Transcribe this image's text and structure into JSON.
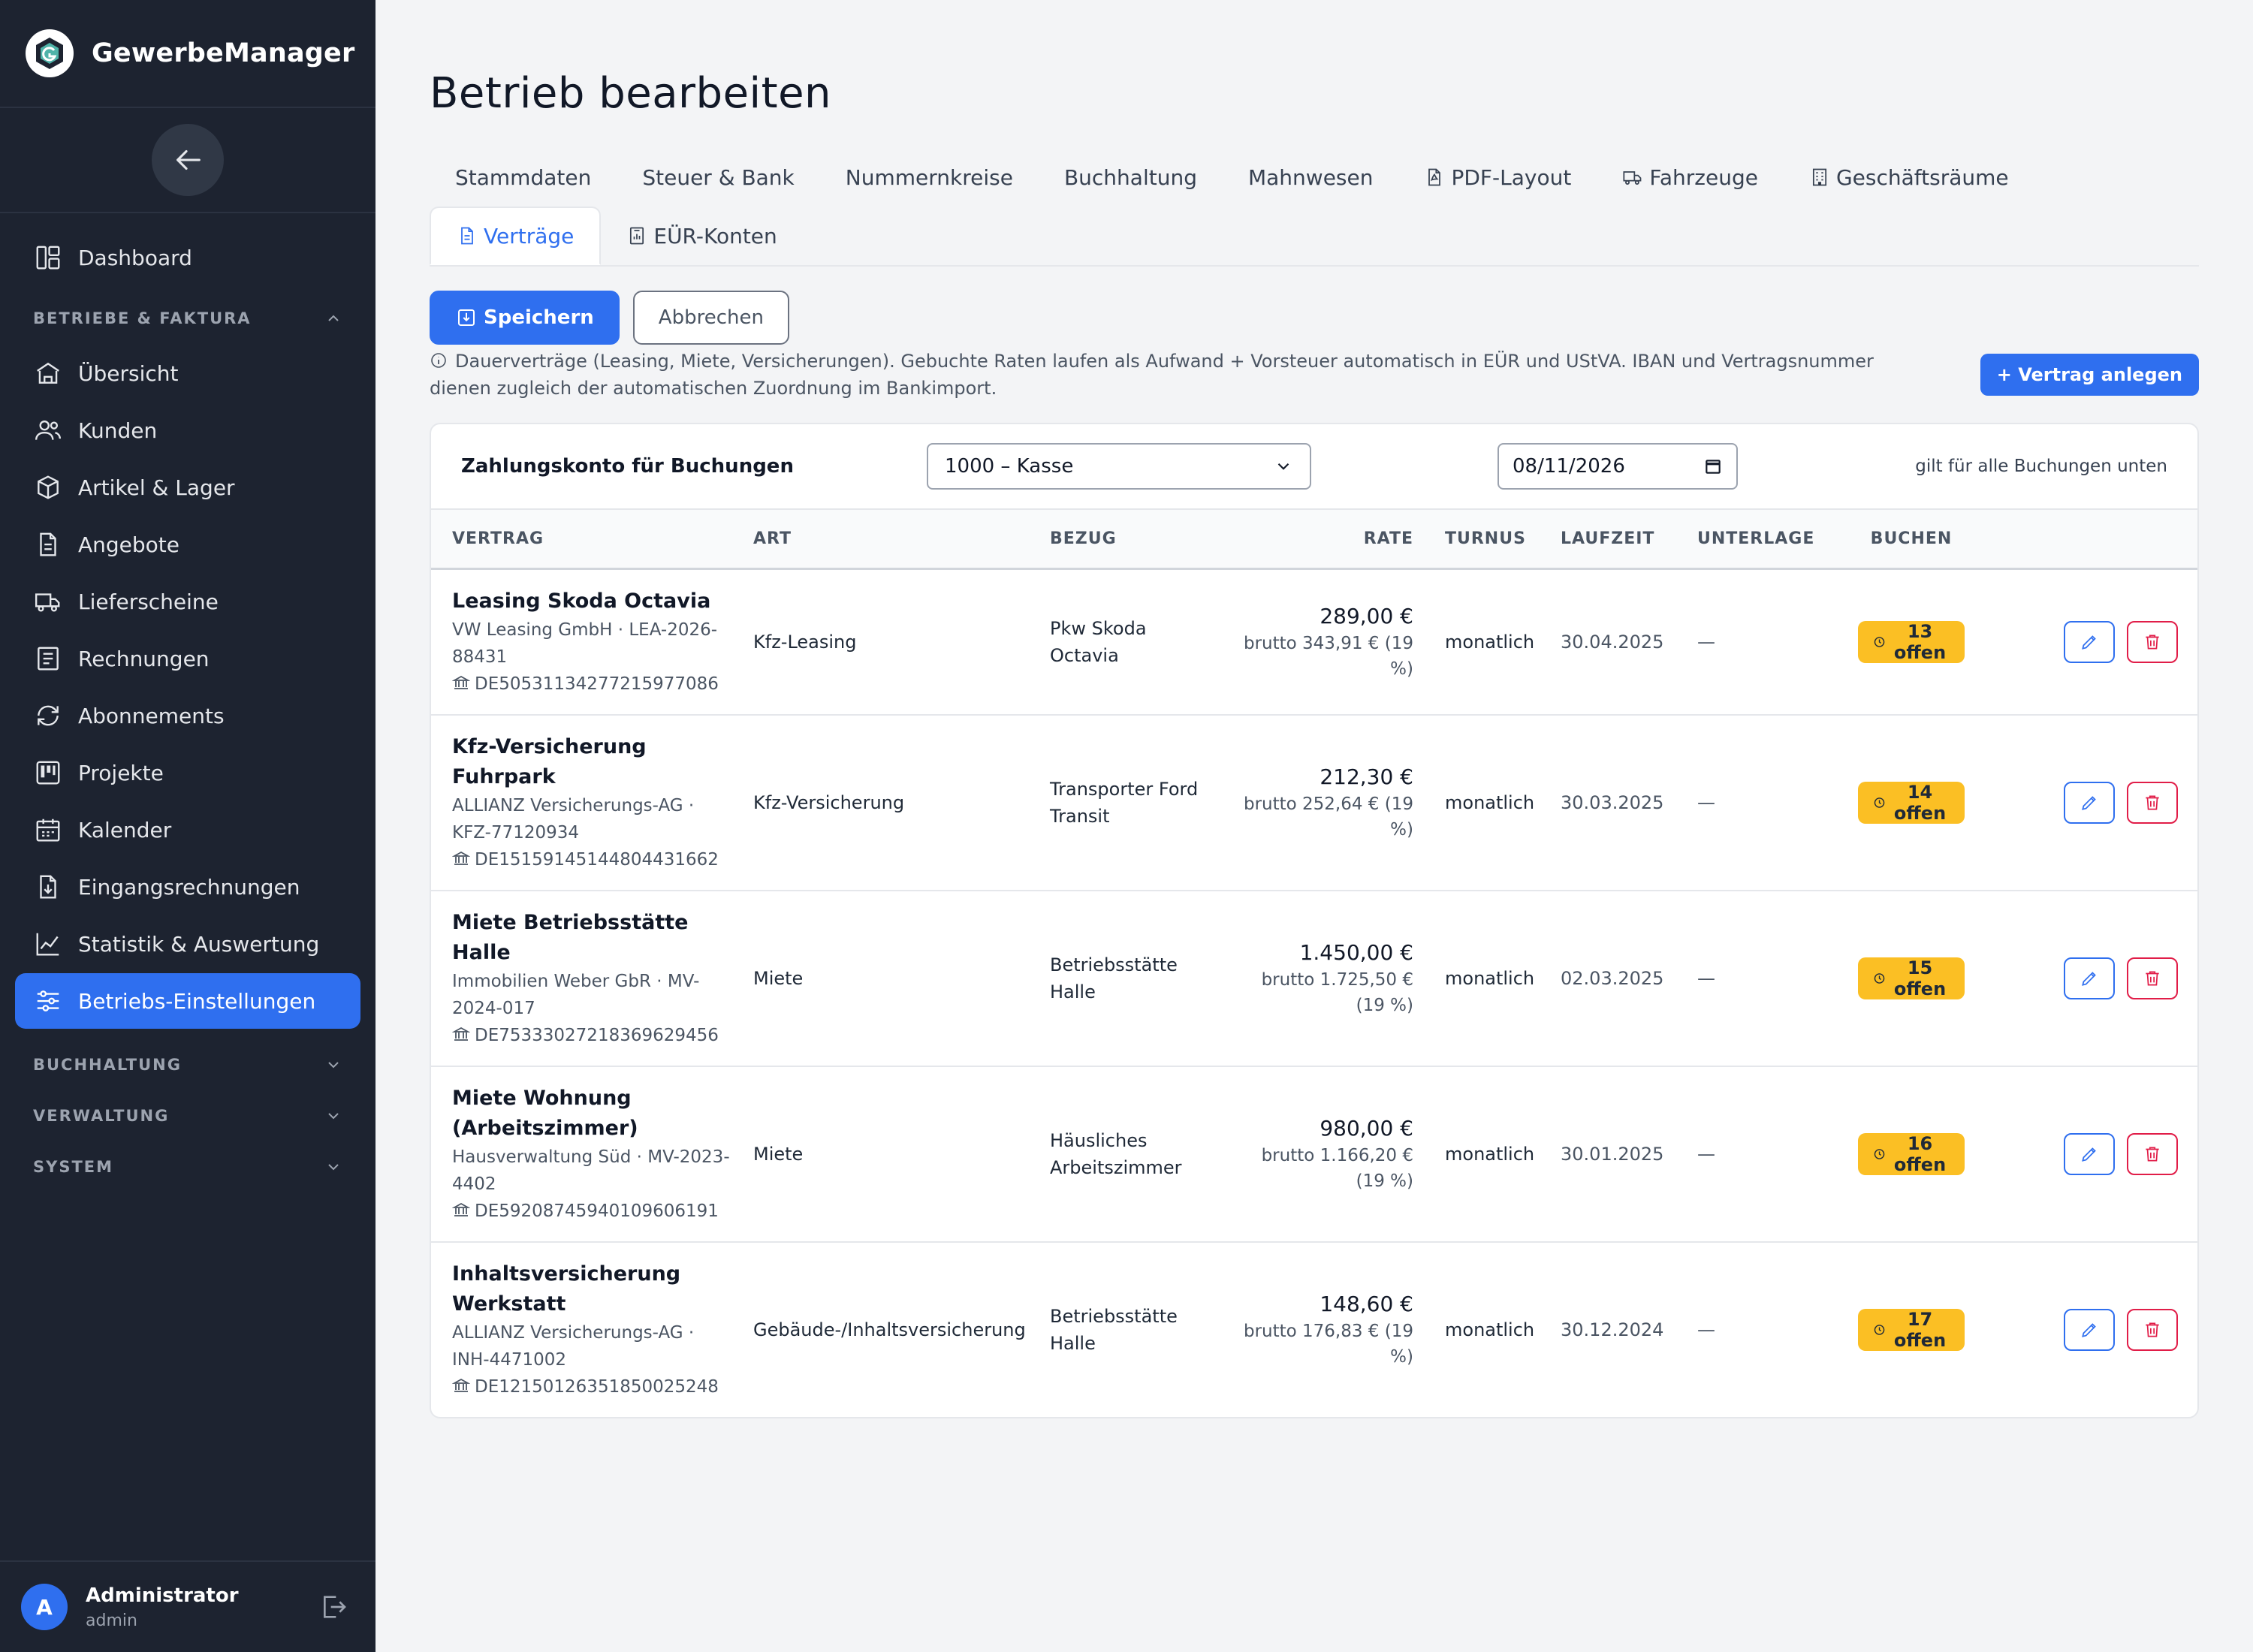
{
  "app": {
    "name": "GewerbeManager"
  },
  "sidebar": {
    "items_top": [
      {
        "label": "Dashboard",
        "icon": "dashboard-icon"
      }
    ],
    "section_betriebe": "BETRIEBE & FAKTURA",
    "items_betriebe": [
      {
        "label": "Übersicht",
        "icon": "building-icon"
      },
      {
        "label": "Kunden",
        "icon": "users-icon"
      },
      {
        "label": "Artikel & Lager",
        "icon": "box-icon"
      },
      {
        "label": "Angebote",
        "icon": "document-icon"
      },
      {
        "label": "Lieferscheine",
        "icon": "truck-icon"
      },
      {
        "label": "Rechnungen",
        "icon": "receipt-icon"
      },
      {
        "label": "Abonnements",
        "icon": "refresh-icon"
      },
      {
        "label": "Projekte",
        "icon": "kanban-icon"
      },
      {
        "label": "Kalender",
        "icon": "calendar-icon"
      },
      {
        "label": "Eingangsrechnungen",
        "icon": "inbox-document-icon"
      },
      {
        "label": "Statistik & Auswertung",
        "icon": "chart-icon"
      },
      {
        "label": "Betriebs-Einstellungen",
        "icon": "sliders-icon",
        "active": true
      }
    ],
    "sections_collapsed": [
      "BUCHHALTUNG",
      "VERWALTUNG",
      "SYSTEM"
    ],
    "user": {
      "initial": "A",
      "name": "Administrator",
      "role": "admin"
    }
  },
  "page": {
    "title": "Betrieb bearbeiten"
  },
  "tabs": [
    {
      "label": "Stammdaten"
    },
    {
      "label": "Steuer & Bank"
    },
    {
      "label": "Nummernkreise"
    },
    {
      "label": "Buchhaltung"
    },
    {
      "label": "Mahnwesen"
    },
    {
      "label": "PDF-Layout",
      "icon": "pdf-icon"
    },
    {
      "label": "Fahrzeuge",
      "icon": "truck-icon"
    },
    {
      "label": "Geschäftsräume",
      "icon": "building-icon"
    },
    {
      "label": "Verträge",
      "icon": "contract-icon",
      "active": true
    },
    {
      "label": "EÜR-Konten",
      "icon": "ledger-icon"
    }
  ],
  "actions": {
    "save": "Speichern",
    "cancel": "Abbrechen",
    "new_contract": "+ Vertrag anlegen"
  },
  "info": "Dauerverträge (Leasing, Miete, Versicherungen). Gebuchte Raten laufen als Aufwand + Vorsteuer automatisch in EÜR und UStVA. IBAN und Vertragsnummer dienen zugleich der automatischen Zuordnung im Bankimport.",
  "booking": {
    "label": "Zahlungskonto für Buchungen",
    "account_selected": "1000 – Kasse",
    "date": "08/11/2026",
    "note": "gilt für alle Buchungen unten"
  },
  "table": {
    "columns": [
      "VERTRAG",
      "ART",
      "BEZUG",
      "RATE",
      "TURNUS",
      "LAUFZEIT",
      "UNTERLAGE",
      "BUCHEN"
    ],
    "rows": [
      {
        "title": "Leasing Skoda Octavia",
        "sub": "VW Leasing GmbH · LEA-2026-88431",
        "iban": "DE50531134277215977086",
        "art": "Kfz-Leasing",
        "bezug": "Pkw Skoda Octavia",
        "rate": "289,00 €",
        "brutto": "brutto 343,91 € (19 %)",
        "turnus": "monatlich",
        "laufzeit": "30.04.2025",
        "unterlage": "—",
        "offen": "13 offen"
      },
      {
        "title": "Kfz-Versicherung Fuhrpark",
        "sub": "ALLIANZ Versicherungs-AG · KFZ-77120934",
        "iban": "DE15159145144804431662",
        "art": "Kfz-Versicherung",
        "bezug": "Transporter Ford Transit",
        "rate": "212,30 €",
        "brutto": "brutto 252,64 € (19 %)",
        "turnus": "monatlich",
        "laufzeit": "30.03.2025",
        "unterlage": "—",
        "offen": "14 offen"
      },
      {
        "title": "Miete Betriebsstätte Halle",
        "sub": "Immobilien Weber GbR · MV-2024-017",
        "iban": "DE75333027218369629456",
        "art": "Miete",
        "bezug": "Betriebsstätte Halle",
        "rate": "1.450,00 €",
        "brutto": "brutto 1.725,50 € (19 %)",
        "turnus": "monatlich",
        "laufzeit": "02.03.2025",
        "unterlage": "—",
        "offen": "15 offen"
      },
      {
        "title": "Miete Wohnung (Arbeitszimmer)",
        "sub": "Hausverwaltung Süd · MV-2023-4402",
        "iban": "DE59208745940109606191",
        "art": "Miete",
        "bezug": "Häusliches Arbeitszimmer",
        "rate": "980,00 €",
        "brutto": "brutto 1.166,20 € (19 %)",
        "turnus": "monatlich",
        "laufzeit": "30.01.2025",
        "unterlage": "—",
        "offen": "16 offen"
      },
      {
        "title": "Inhaltsversicherung Werkstatt",
        "sub": "ALLIANZ Versicherungs-AG · INH-4471002",
        "iban": "DE12150126351850025248",
        "art": "Gebäude-/Inhaltsversicherung",
        "bezug": "Betriebsstätte Halle",
        "rate": "148,60 €",
        "brutto": "brutto 176,83 € (19 %)",
        "turnus": "monatlich",
        "laufzeit": "30.12.2024",
        "unterlage": "—",
        "offen": "17 offen"
      }
    ]
  },
  "colors": {
    "primary": "#2f6fef",
    "sidebar_bg": "#1d2330",
    "badge": "#fbbf24",
    "danger": "#e11d48"
  }
}
